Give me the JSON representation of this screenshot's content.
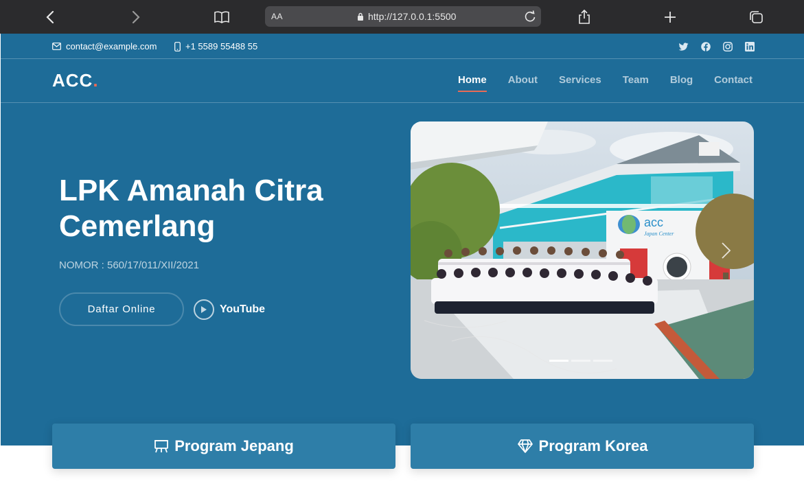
{
  "browser": {
    "text_size_label": "AA",
    "url": "http://127.0.0.1:5500"
  },
  "topbar": {
    "email": "contact@example.com",
    "phone": "+1 5589 55488 55",
    "socials": [
      "twitter-icon",
      "facebook-icon",
      "instagram-icon",
      "linkedin-icon"
    ]
  },
  "header": {
    "logo": "ACC",
    "logo_dot": ".",
    "nav": [
      {
        "label": "Home",
        "active": true
      },
      {
        "label": "About",
        "active": false
      },
      {
        "label": "Services",
        "active": false
      },
      {
        "label": "Team",
        "active": false
      },
      {
        "label": "Blog",
        "active": false
      },
      {
        "label": "Contact",
        "active": false
      }
    ]
  },
  "hero": {
    "title": "LPK Amanah Citra Cemerlang",
    "subtitle": "NOMOR : 560/17/011/XII/2021",
    "primary_button": "Daftar Online",
    "video_link": "YouTube"
  },
  "carousel": {
    "sign_text": "acc",
    "sign_subtext": "Japan Center",
    "slide_count": 3,
    "active_slide": 0
  },
  "programs": [
    {
      "label": "Program Jepang",
      "icon": "easel-icon"
    },
    {
      "label": "Program Korea",
      "icon": "gem-icon"
    }
  ],
  "colors": {
    "hero_bg": "#1e6c98",
    "card_bg": "#2e7ea8",
    "accent": "#e96b56",
    "chrome_bg": "#2b2b2d"
  }
}
